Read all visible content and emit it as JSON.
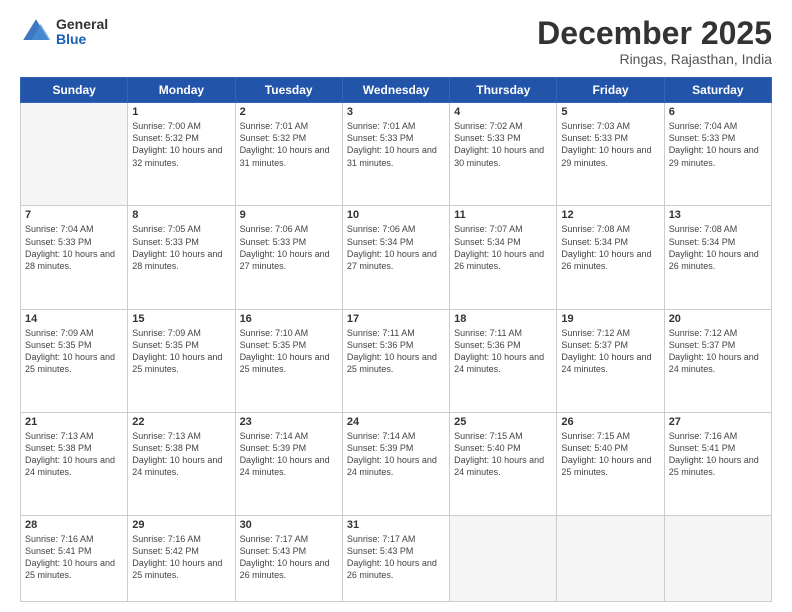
{
  "logo": {
    "general": "General",
    "blue": "Blue"
  },
  "header": {
    "month": "December 2025",
    "location": "Ringas, Rajasthan, India"
  },
  "days_of_week": [
    "Sunday",
    "Monday",
    "Tuesday",
    "Wednesday",
    "Thursday",
    "Friday",
    "Saturday"
  ],
  "weeks": [
    [
      {
        "day": "",
        "empty": true
      },
      {
        "day": "1",
        "sunrise": "7:00 AM",
        "sunset": "5:32 PM",
        "daylight": "10 hours and 32 minutes."
      },
      {
        "day": "2",
        "sunrise": "7:01 AM",
        "sunset": "5:32 PM",
        "daylight": "10 hours and 31 minutes."
      },
      {
        "day": "3",
        "sunrise": "7:01 AM",
        "sunset": "5:33 PM",
        "daylight": "10 hours and 31 minutes."
      },
      {
        "day": "4",
        "sunrise": "7:02 AM",
        "sunset": "5:33 PM",
        "daylight": "10 hours and 30 minutes."
      },
      {
        "day": "5",
        "sunrise": "7:03 AM",
        "sunset": "5:33 PM",
        "daylight": "10 hours and 29 minutes."
      },
      {
        "day": "6",
        "sunrise": "7:04 AM",
        "sunset": "5:33 PM",
        "daylight": "10 hours and 29 minutes."
      }
    ],
    [
      {
        "day": "7",
        "sunrise": "7:04 AM",
        "sunset": "5:33 PM",
        "daylight": "10 hours and 28 minutes."
      },
      {
        "day": "8",
        "sunrise": "7:05 AM",
        "sunset": "5:33 PM",
        "daylight": "10 hours and 28 minutes."
      },
      {
        "day": "9",
        "sunrise": "7:06 AM",
        "sunset": "5:33 PM",
        "daylight": "10 hours and 27 minutes."
      },
      {
        "day": "10",
        "sunrise": "7:06 AM",
        "sunset": "5:34 PM",
        "daylight": "10 hours and 27 minutes."
      },
      {
        "day": "11",
        "sunrise": "7:07 AM",
        "sunset": "5:34 PM",
        "daylight": "10 hours and 26 minutes."
      },
      {
        "day": "12",
        "sunrise": "7:08 AM",
        "sunset": "5:34 PM",
        "daylight": "10 hours and 26 minutes."
      },
      {
        "day": "13",
        "sunrise": "7:08 AM",
        "sunset": "5:34 PM",
        "daylight": "10 hours and 26 minutes."
      }
    ],
    [
      {
        "day": "14",
        "sunrise": "7:09 AM",
        "sunset": "5:35 PM",
        "daylight": "10 hours and 25 minutes."
      },
      {
        "day": "15",
        "sunrise": "7:09 AM",
        "sunset": "5:35 PM",
        "daylight": "10 hours and 25 minutes."
      },
      {
        "day": "16",
        "sunrise": "7:10 AM",
        "sunset": "5:35 PM",
        "daylight": "10 hours and 25 minutes."
      },
      {
        "day": "17",
        "sunrise": "7:11 AM",
        "sunset": "5:36 PM",
        "daylight": "10 hours and 25 minutes."
      },
      {
        "day": "18",
        "sunrise": "7:11 AM",
        "sunset": "5:36 PM",
        "daylight": "10 hours and 24 minutes."
      },
      {
        "day": "19",
        "sunrise": "7:12 AM",
        "sunset": "5:37 PM",
        "daylight": "10 hours and 24 minutes."
      },
      {
        "day": "20",
        "sunrise": "7:12 AM",
        "sunset": "5:37 PM",
        "daylight": "10 hours and 24 minutes."
      }
    ],
    [
      {
        "day": "21",
        "sunrise": "7:13 AM",
        "sunset": "5:38 PM",
        "daylight": "10 hours and 24 minutes."
      },
      {
        "day": "22",
        "sunrise": "7:13 AM",
        "sunset": "5:38 PM",
        "daylight": "10 hours and 24 minutes."
      },
      {
        "day": "23",
        "sunrise": "7:14 AM",
        "sunset": "5:39 PM",
        "daylight": "10 hours and 24 minutes."
      },
      {
        "day": "24",
        "sunrise": "7:14 AM",
        "sunset": "5:39 PM",
        "daylight": "10 hours and 24 minutes."
      },
      {
        "day": "25",
        "sunrise": "7:15 AM",
        "sunset": "5:40 PM",
        "daylight": "10 hours and 24 minutes."
      },
      {
        "day": "26",
        "sunrise": "7:15 AM",
        "sunset": "5:40 PM",
        "daylight": "10 hours and 25 minutes."
      },
      {
        "day": "27",
        "sunrise": "7:16 AM",
        "sunset": "5:41 PM",
        "daylight": "10 hours and 25 minutes."
      }
    ],
    [
      {
        "day": "28",
        "sunrise": "7:16 AM",
        "sunset": "5:41 PM",
        "daylight": "10 hours and 25 minutes."
      },
      {
        "day": "29",
        "sunrise": "7:16 AM",
        "sunset": "5:42 PM",
        "daylight": "10 hours and 25 minutes."
      },
      {
        "day": "30",
        "sunrise": "7:17 AM",
        "sunset": "5:43 PM",
        "daylight": "10 hours and 26 minutes."
      },
      {
        "day": "31",
        "sunrise": "7:17 AM",
        "sunset": "5:43 PM",
        "daylight": "10 hours and 26 minutes."
      },
      {
        "day": "",
        "empty": true
      },
      {
        "day": "",
        "empty": true
      },
      {
        "day": "",
        "empty": true
      }
    ]
  ]
}
